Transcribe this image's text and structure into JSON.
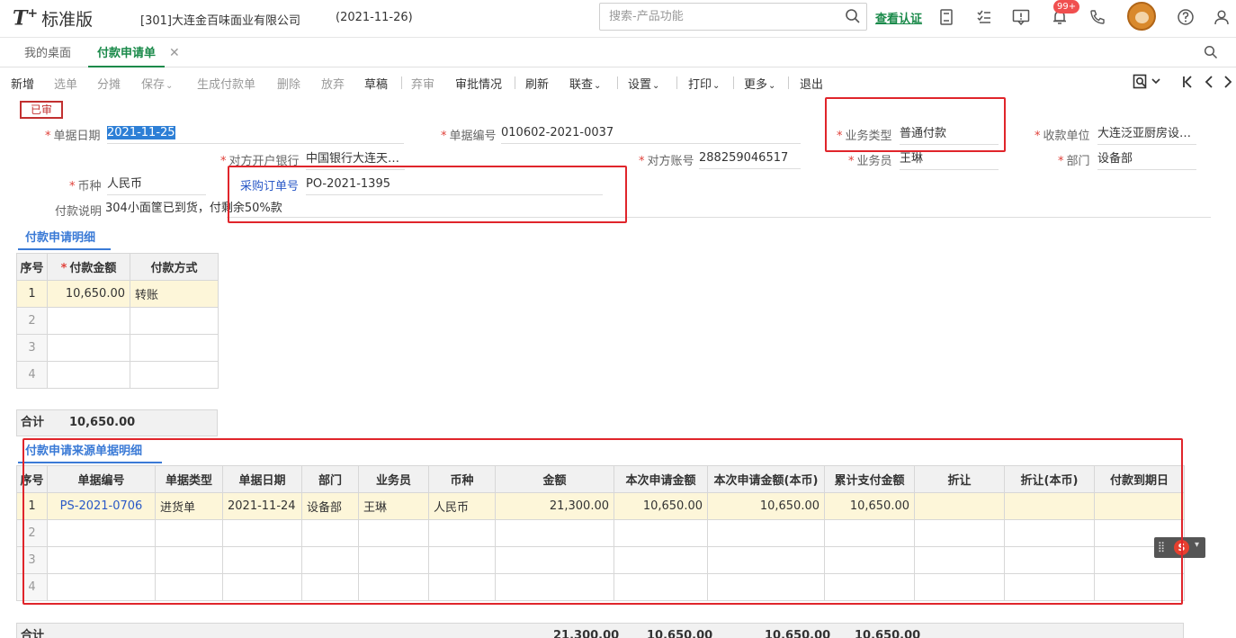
{
  "header": {
    "logo_mark": "T",
    "logo_plus": "+",
    "logo_text": "标准版",
    "company": "[301]大连金百味面业有限公司",
    "date": "(2021-11-26)",
    "search_placeholder": "搜索-产品功能",
    "auth_link": "查看认证",
    "notification_badge": "99+"
  },
  "tabs": [
    {
      "label": "我的桌面"
    },
    {
      "label": "付款申请单"
    }
  ],
  "toolbar": {
    "new": "新增",
    "select": "选单",
    "allocate": "分摊",
    "save": "保存",
    "gen_payment": "生成付款单",
    "delete": "删除",
    "abandon": "放弃",
    "draft": "草稿",
    "unreview": "弃审",
    "approval": "审批情况",
    "refresh": "刷新",
    "link_query": "联查",
    "settings": "设置",
    "print": "打印",
    "more": "更多",
    "exit": "退出"
  },
  "status_stamp": "已审",
  "form": {
    "date_label": "单据日期",
    "date_value": "2021-11-25",
    "doc_no_label": "单据编号",
    "doc_no_value": "010602-2021-0037",
    "biz_type_label": "业务类型",
    "biz_type_value": "普通付款",
    "payee_label": "收款单位",
    "payee_value": "大连泛亚厨房设…",
    "bank_label": "对方开户银行",
    "bank_value": "中国银行大连天…",
    "account_label": "对方账号",
    "account_value": "288259046517",
    "staff_label": "业务员",
    "staff_value": "王琳",
    "dept_label": "部门",
    "dept_value": "设备部",
    "currency_label": "币种",
    "currency_value": "人民币",
    "po_label": "采购订单号",
    "po_value": "PO-2021-1395",
    "remark_label": "付款说明",
    "remark_value": "304小面筐已到货，付剩余50%款"
  },
  "detail": {
    "title": "付款申请明细",
    "headers": [
      "序号",
      "付款金额",
      "付款方式"
    ],
    "rows": [
      {
        "idx": "1",
        "amount": "10,650.00",
        "method": "转账"
      },
      {
        "idx": "2",
        "amount": "",
        "method": ""
      },
      {
        "idx": "3",
        "amount": "",
        "method": ""
      },
      {
        "idx": "4",
        "amount": "",
        "method": ""
      }
    ],
    "total_label": "合计",
    "total_value": "10,650.00"
  },
  "source": {
    "title": "付款申请来源单据明细",
    "headers": [
      "序号",
      "单据编号",
      "单据类型",
      "单据日期",
      "部门",
      "业务员",
      "币种",
      "金额",
      "本次申请金额",
      "本次申请金额(本币)",
      "累计支付金额",
      "折让",
      "折让(本币)",
      "付款到期日"
    ],
    "rows": [
      [
        "1",
        "PS-2021-0706",
        "进货单",
        "2021-11-24",
        "设备部",
        "王琳",
        "人民币",
        "21,300.00",
        "10,650.00",
        "10,650.00",
        "10,650.00",
        "",
        "",
        ""
      ],
      [
        "2",
        "",
        "",
        "",
        "",
        "",
        "",
        "",
        "",
        "",
        "",
        "",
        "",
        ""
      ],
      [
        "3",
        "",
        "",
        "",
        "",
        "",
        "",
        "",
        "",
        "",
        "",
        "",
        "",
        ""
      ],
      [
        "4",
        "",
        "",
        "",
        "",
        "",
        "",
        "",
        "",
        "",
        "",
        "",
        "",
        ""
      ]
    ],
    "total_label": "合计",
    "totals": [
      "21,300.00",
      "10,650.00",
      "10,650.00",
      "10,650.00"
    ]
  }
}
